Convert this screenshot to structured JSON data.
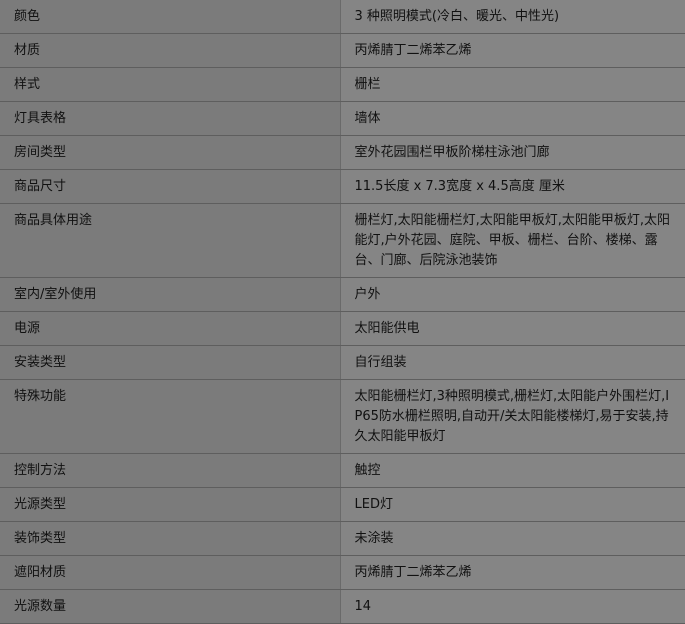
{
  "spec_table": {
    "rows": [
      {
        "label": "颜色",
        "value": "3 种照明模式(冷白、暖光、中性光)"
      },
      {
        "label": "材质",
        "value": "丙烯腈丁二烯苯乙烯"
      },
      {
        "label": "样式",
        "value": "栅栏"
      },
      {
        "label": "灯具表格",
        "value": "墙体"
      },
      {
        "label": "房间类型",
        "value": "室外花园围栏甲板阶梯柱泳池门廊"
      },
      {
        "label": "商品尺寸",
        "value": "11.5长度 x 7.3宽度 x 4.5高度 厘米"
      },
      {
        "label": "商品具体用途",
        "value": "栅栏灯,太阳能栅栏灯,太阳能甲板灯,太阳能甲板灯,太阳能灯,户外花园、庭院、甲板、栅栏、台阶、楼梯、露台、门廊、后院泳池装饰"
      },
      {
        "label": "室内/室外使用",
        "value": "户外"
      },
      {
        "label": "电源",
        "value": "太阳能供电"
      },
      {
        "label": "安装类型",
        "value": "自行组装"
      },
      {
        "label": "特殊功能",
        "value": "太阳能栅栏灯,3种照明模式,栅栏灯,太阳能户外围栏灯,IP65防水栅栏照明,自动开/关太阳能楼梯灯,易于安装,持久太阳能甲板灯"
      },
      {
        "label": "控制方法",
        "value": "触控"
      },
      {
        "label": "光源类型",
        "value": "LED灯"
      },
      {
        "label": "装饰类型",
        "value": "未涂装"
      },
      {
        "label": "遮阳材质",
        "value": "丙烯腈丁二烯苯乙烯"
      },
      {
        "label": "光源数量",
        "value": "14"
      }
    ]
  }
}
